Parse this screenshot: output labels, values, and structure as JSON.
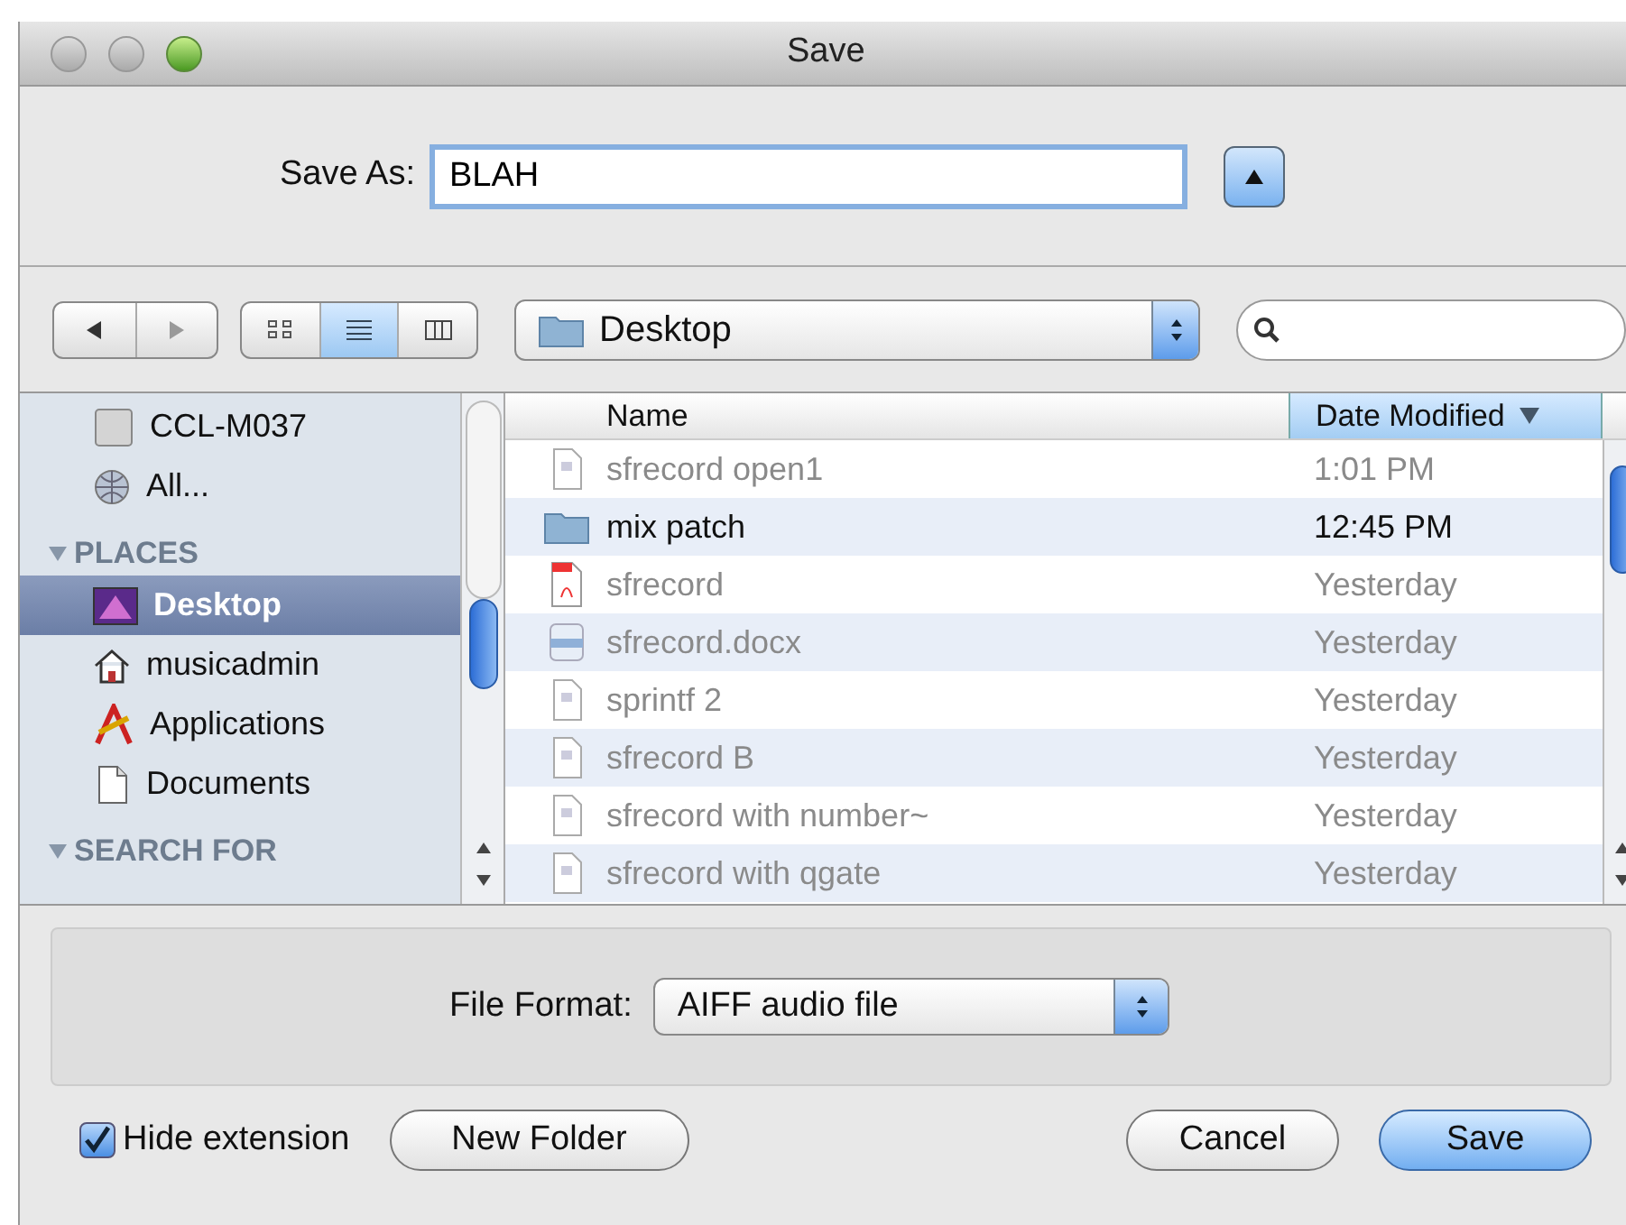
{
  "window": {
    "title": "Save"
  },
  "save_as": {
    "label": "Save As:",
    "value": "BLAH",
    "expanded": false
  },
  "toolbar": {
    "view_modes": [
      {
        "kind": "icons",
        "selected": false
      },
      {
        "kind": "list",
        "selected": true
      },
      {
        "kind": "columns",
        "selected": false
      }
    ],
    "location": "Desktop"
  },
  "sidebar": {
    "items": [
      {
        "kind": "drive",
        "label": "CCL-M037",
        "selected": false
      },
      {
        "kind": "network",
        "label": "All...",
        "selected": false
      },
      {
        "kind": "header",
        "label": "PLACES",
        "expanded": true
      },
      {
        "kind": "desktop",
        "label": "Desktop",
        "selected": true
      },
      {
        "kind": "home",
        "label": "musicadmin",
        "selected": false
      },
      {
        "kind": "apps",
        "label": "Applications",
        "selected": false
      },
      {
        "kind": "document",
        "label": "Documents",
        "selected": false
      },
      {
        "kind": "header",
        "label": "SEARCH FOR",
        "expanded": true
      }
    ]
  },
  "table": {
    "columns": [
      {
        "label": "Name",
        "selected": false
      },
      {
        "label": "Date Modified",
        "selected": true
      }
    ],
    "rows": [
      {
        "kind": "file",
        "name": "sfrecord open1",
        "date": "1:01 PM",
        "disabled": true
      },
      {
        "kind": "folder",
        "name": "mix patch",
        "date": "12:45 PM",
        "disabled": false
      },
      {
        "kind": "pdf",
        "name": "sfrecord",
        "date": "Yesterday",
        "disabled": true
      },
      {
        "kind": "docx",
        "name": "sfrecord.docx",
        "date": "Yesterday",
        "disabled": true
      },
      {
        "kind": "file",
        "name": "sprintf 2",
        "date": "Yesterday",
        "disabled": true
      },
      {
        "kind": "file",
        "name": "sfrecord B",
        "date": "Yesterday",
        "disabled": true
      },
      {
        "kind": "file",
        "name": "sfrecord with number~",
        "date": "Yesterday",
        "disabled": true
      },
      {
        "kind": "file",
        "name": "sfrecord with qgate",
        "date": "Yesterday",
        "disabled": true
      }
    ]
  },
  "file_format": {
    "label": "File Format:",
    "value": "AIFF audio file"
  },
  "hide_extension": {
    "label": "Hide extension",
    "checked": true
  },
  "buttons": [
    {
      "label": "New Folder",
      "kind": "plain"
    },
    {
      "label": "Cancel",
      "kind": "plain"
    },
    {
      "label": "Save",
      "kind": "default"
    }
  ]
}
